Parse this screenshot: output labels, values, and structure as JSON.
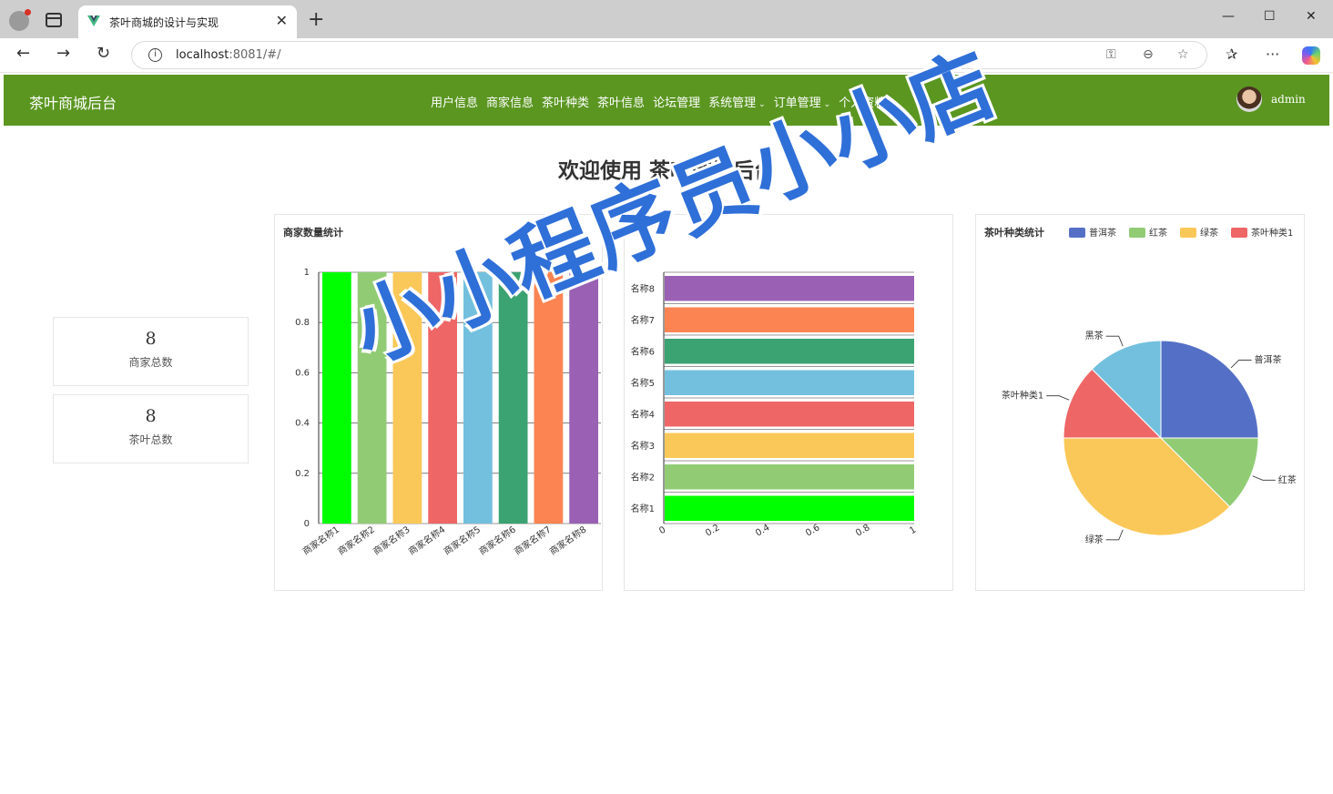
{
  "browser": {
    "tab_title": "茶叶商城的设计与实现",
    "url_host": "localhost",
    "url_rest": ":8081/#/"
  },
  "header": {
    "brand": "茶叶商城后台",
    "nav": [
      {
        "label": "用户信息",
        "caret": false
      },
      {
        "label": "商家信息",
        "caret": false
      },
      {
        "label": "茶叶种类",
        "caret": false
      },
      {
        "label": "茶叶信息",
        "caret": false
      },
      {
        "label": "论坛管理",
        "caret": false
      },
      {
        "label": "系统管理",
        "caret": true
      },
      {
        "label": "订单管理",
        "caret": true
      },
      {
        "label": "个人资料",
        "caret": false
      }
    ],
    "username": "admin"
  },
  "welcome": "欢迎使用 茶叶商城后台",
  "stats": [
    {
      "value": "8",
      "label": "商家总数"
    },
    {
      "value": "8",
      "label": "茶叶总数"
    }
  ],
  "watermark": "小小程序员小小店",
  "colors": {
    "header_bg": "#5b9621",
    "palette": [
      "#00ff00",
      "#91cc75",
      "#fac858",
      "#ee6666",
      "#73c0de",
      "#3ba272",
      "#fc8452",
      "#9a60b4"
    ],
    "pie_palette": [
      "#5470c6",
      "#91cc75",
      "#fac858",
      "#ee6666",
      "#73c0de"
    ]
  },
  "chart_data": [
    {
      "type": "bar",
      "title": "商家数量统计",
      "categories": [
        "商家名称1",
        "商家名称2",
        "商家名称3",
        "商家名称4",
        "商家名称5",
        "商家名称6",
        "商家名称7",
        "商家名称8"
      ],
      "values": [
        1,
        1,
        1,
        1,
        1,
        1,
        1,
        1
      ],
      "ylim": [
        0,
        1
      ],
      "yticks": [
        "0",
        "0.2",
        "0.4",
        "0.6",
        "0.8",
        "1"
      ],
      "grid": true
    },
    {
      "type": "bar",
      "orientation": "horizontal",
      "title": "",
      "categories": [
        "名称1",
        "名称2",
        "名称3",
        "名称4",
        "名称5",
        "名称6",
        "名称7",
        "名称8"
      ],
      "values": [
        1,
        1,
        1,
        1,
        1,
        1,
        1,
        1
      ],
      "xlim": [
        0,
        1
      ],
      "xticks": [
        "0",
        "0.2",
        "0.4",
        "0.6",
        "0.8",
        "1"
      ],
      "grid": true
    },
    {
      "type": "pie",
      "title": "茶叶种类统计",
      "legend": [
        "普洱茶",
        "红茶",
        "绿茶",
        "茶叶种类1",
        "黑茶"
      ],
      "legend_position": "top",
      "slices": [
        {
          "name": "普洱茶",
          "value": 2
        },
        {
          "name": "红茶",
          "value": 1
        },
        {
          "name": "绿茶",
          "value": 3
        },
        {
          "name": "茶叶种类1",
          "value": 1
        },
        {
          "name": "黑茶",
          "value": 1
        }
      ]
    }
  ]
}
